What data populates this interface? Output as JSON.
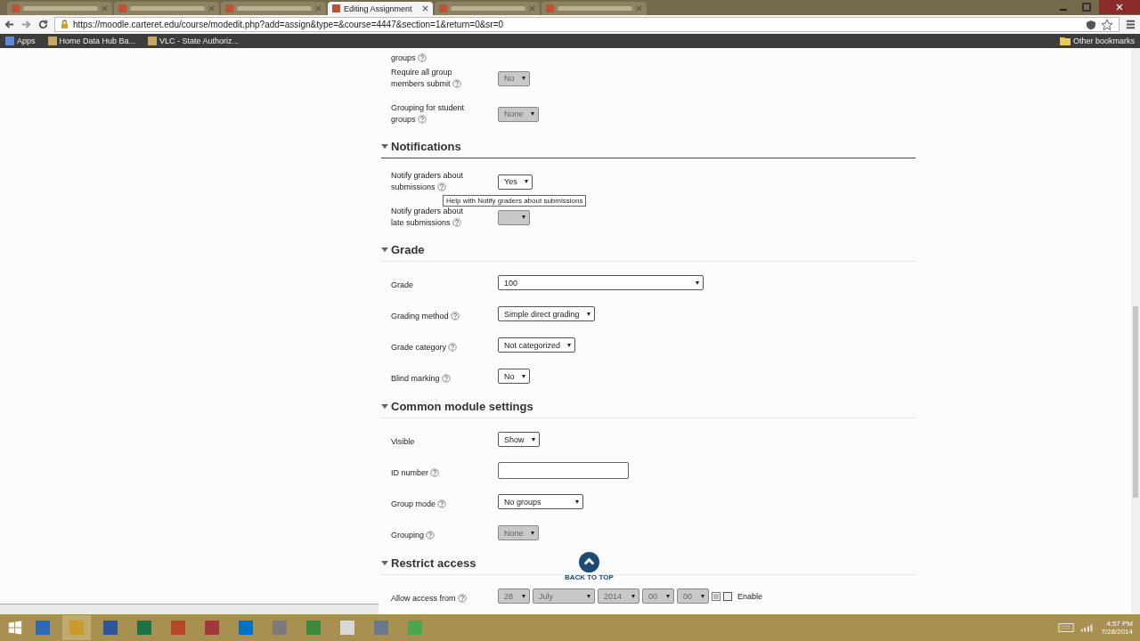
{
  "browser": {
    "tabs": [
      {
        "selected": false
      },
      {
        "selected": false
      },
      {
        "selected": false
      },
      {
        "title": "Editing Assignment",
        "selected": true
      },
      {
        "selected": false
      },
      {
        "selected": false
      }
    ],
    "url": "https://moodle.carteret.edu/course/modedit.php?add=assign&type=&course=4447&section=1&return=0&sr=0",
    "bookmarks": [
      "Apps",
      "Home Data Hub Ba...",
      "VLC - State Authoriz..."
    ],
    "other_bookmarks": "Other bookmarks"
  },
  "sections": [
    {
      "fields": [
        {
          "label": "groups",
          "help": true,
          "kind": "partial"
        },
        {
          "label": "Require all group members submit",
          "help": true,
          "kind": "select",
          "value": "No",
          "disabled": true
        },
        {
          "label": "Grouping for student groups",
          "help": true,
          "kind": "select",
          "value": "None",
          "disabled": true
        }
      ]
    },
    {
      "title": "Notifications",
      "expanded": true,
      "fields": [
        {
          "label": "Notify graders about submissions",
          "help": true,
          "kind": "select",
          "value": "Yes",
          "disabled": false,
          "tooltip": "Help with Notify graders about submissions"
        },
        {
          "label": "Notify graders about late submissions",
          "help": true,
          "kind": "select",
          "disabled": true
        }
      ]
    },
    {
      "title": "Grade",
      "expanded": true,
      "fields": [
        {
          "label": "Grade",
          "help": false,
          "kind": "select",
          "value": "100",
          "disabled": false
        },
        {
          "label": "Grading method",
          "help": true,
          "kind": "select",
          "value": "Simple direct grading",
          "disabled": false
        },
        {
          "label": "Grade category",
          "help": true,
          "kind": "select",
          "value": "Not categorized",
          "disabled": false
        },
        {
          "label": "Blind marking",
          "help": true,
          "kind": "select",
          "value": "No",
          "disabled": false
        }
      ]
    },
    {
      "title": "Common module settings",
      "expanded": true,
      "fields": [
        {
          "label": "Visible",
          "help": false,
          "kind": "select",
          "value": "Show",
          "disabled": false
        },
        {
          "label": "ID number",
          "help": true,
          "kind": "text"
        },
        {
          "label": "Group mode",
          "help": true,
          "kind": "select",
          "value": "No groups",
          "disabled": false
        },
        {
          "label": "Grouping",
          "help": true,
          "kind": "select",
          "value": "None",
          "disabled": true
        }
      ]
    },
    {
      "title": "Restrict access",
      "expanded": true,
      "fields": [
        {
          "label": "Allow access from",
          "help": true,
          "kind": "date",
          "parts": [
            "28",
            "July",
            "2014",
            "00",
            "00"
          ],
          "disabled": true,
          "enable": {
            "label": "Enable",
            "checked": false
          }
        }
      ]
    }
  ],
  "back_to_top": "BACK TO TOP",
  "clock": {
    "time": "4:57 PM",
    "date": "7/28/2014"
  }
}
